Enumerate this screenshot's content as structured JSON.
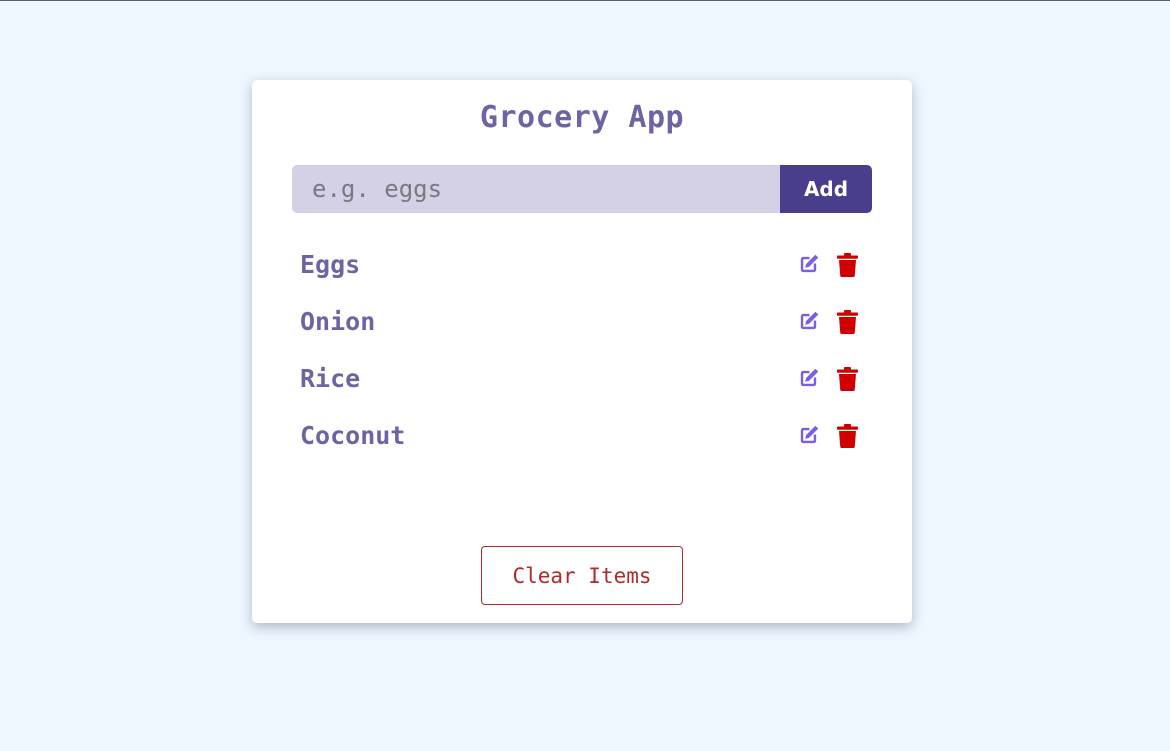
{
  "app": {
    "title": "Grocery App"
  },
  "form": {
    "input_placeholder": "e.g. eggs",
    "input_value": "",
    "submit_label": "Add"
  },
  "items": [
    {
      "name": "Eggs"
    },
    {
      "name": "Onion"
    },
    {
      "name": "Rice"
    },
    {
      "name": "Coconut"
    }
  ],
  "actions": {
    "clear_label": "Clear Items"
  },
  "colors": {
    "page_background": "#eef6ff",
    "accent_text": "#6e64a3",
    "add_button": "#493e8c",
    "input_background": "#d4d0e6",
    "edit_icon": "#7b5ee6",
    "delete_icon": "#d10000",
    "clear_button": "#b02a2a"
  },
  "icons": {
    "edit": "edit-icon",
    "delete": "trash-icon"
  }
}
